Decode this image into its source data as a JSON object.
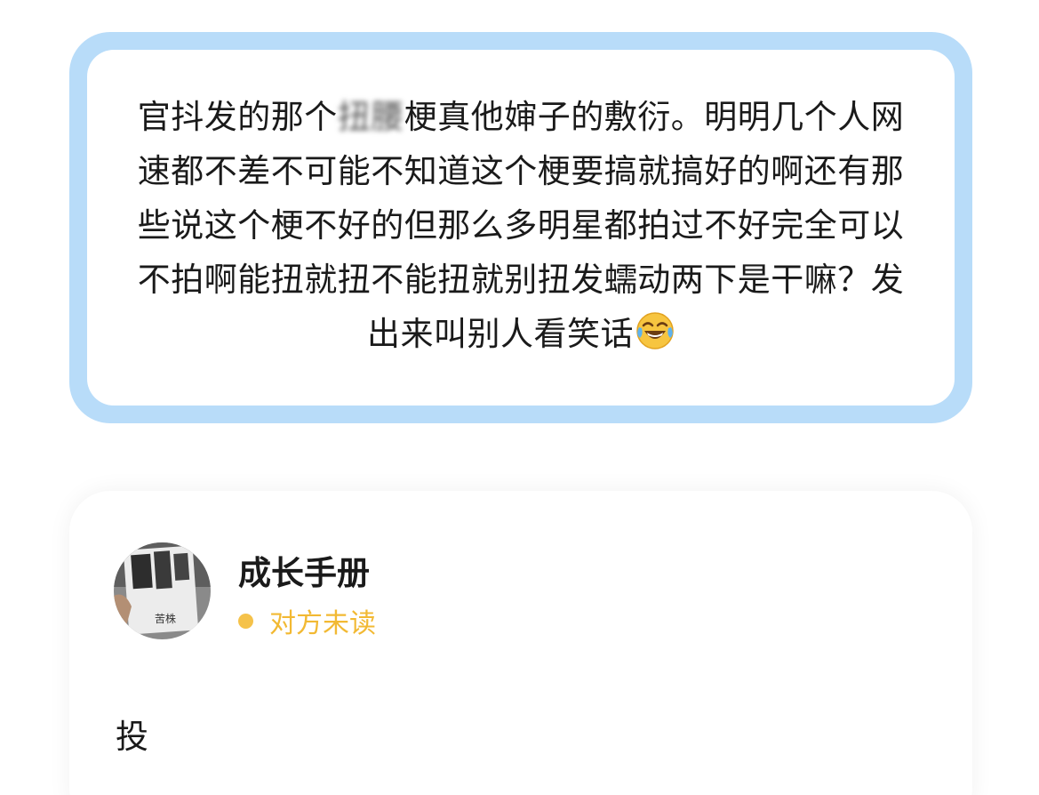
{
  "quote": {
    "line_parts": {
      "before_blur": "官抖发的那个",
      "blurred": "扭腰",
      "after_blur": "梗真他婶子的敷衍。明明几个人网速都不差不可能不知道这个梗要搞就搞好的啊还有那些说这个梗不好的但那么多明星都拍过不好完全可以不拍啊能扭就扭不能扭就别扭发蠕动两下是干嘛？发出来叫别人看笑话"
    },
    "emoji": "face-with-tears-of-joy-icon",
    "border_color": "#b8dcf9"
  },
  "chat": {
    "contact_name": "成长手册",
    "avatar_caption": "苦株",
    "status_text": "对方未读",
    "status_color": "#f2b933",
    "message": "投"
  }
}
